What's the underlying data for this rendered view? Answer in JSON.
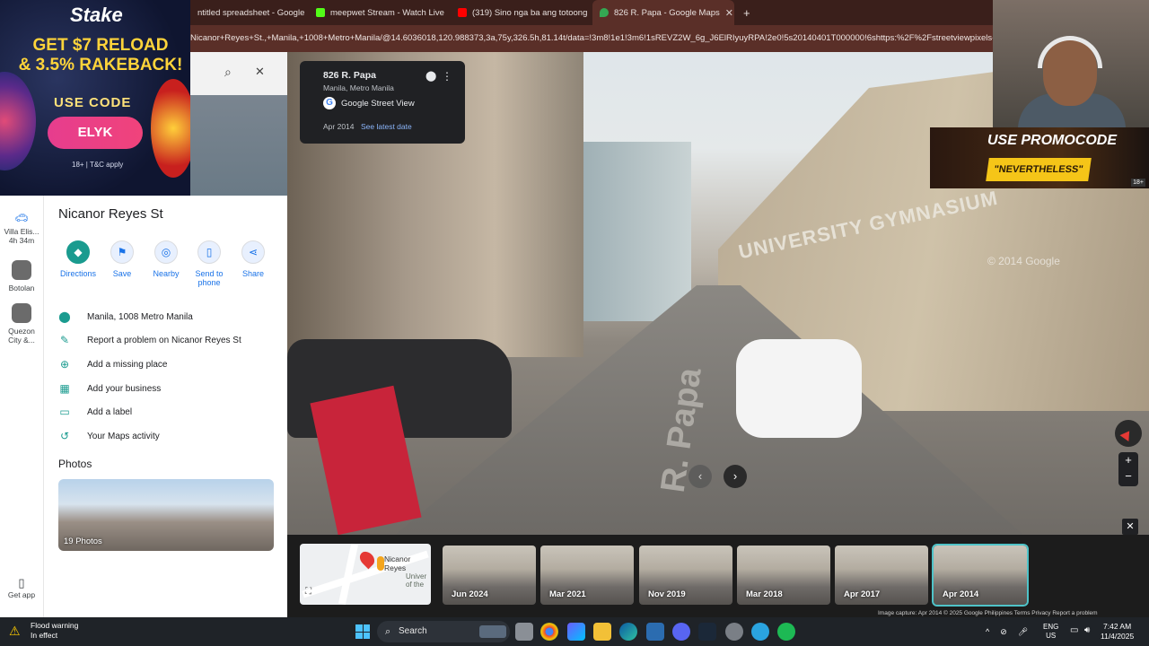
{
  "browser": {
    "tabs": [
      {
        "label": "ntitled spreadsheet - Google",
        "color": "#0f9d58"
      },
      {
        "label": "meepwet Stream - Watch Live",
        "color": "#53fc18"
      },
      {
        "label": "(319) Sino nga ba ang totoong",
        "color": "#ff0000"
      },
      {
        "label": "826 R. Papa - Google Maps",
        "color": "#34a853"
      }
    ],
    "new_tab": "+",
    "url": "Nicanor+Reyes+St.,+Manila,+1008+Metro+Manila/@14.6036018,120.988373,3a,75y,326.5h,81.14t/data=!3m8!1e1!3m6!1sREVZ2W_6g_J6ElRIyuyRPA!2e0!5s20140401T000000!6shttps:%2F%2Fstreetviewpixels-pa.googleap"
  },
  "ad": {
    "brand": "Stake",
    "line1": "GET $7 RELOAD",
    "line2": "& 3.5% RAKEBACK!",
    "use_code": "USE CODE",
    "code": "ELYK",
    "terms": "18+ | T&C apply"
  },
  "leftrail": [
    {
      "label": "Villa Elis...",
      "sub": "4h 34m"
    },
    {
      "label": "Botolan",
      "sub": ""
    },
    {
      "label": "Quezon",
      "sub": "City &..."
    }
  ],
  "get_app": "Get app",
  "panel": {
    "title": "Nicanor Reyes St",
    "actions": [
      {
        "label": "Directions",
        "icon": "◆"
      },
      {
        "label": "Save",
        "icon": "⚑"
      },
      {
        "label": "Nearby",
        "icon": "◎"
      },
      {
        "label": "Send to phone",
        "icon": "▯"
      },
      {
        "label": "Share",
        "icon": "⋖"
      }
    ],
    "rows": [
      {
        "label": "Manila, 1008 Metro Manila",
        "icon": "location-pin-icon"
      },
      {
        "label": "Report a problem on Nicanor Reyes St",
        "icon": "pencil-icon"
      },
      {
        "label": "Add a missing place",
        "icon": "add-place-icon"
      },
      {
        "label": "Add your business",
        "icon": "store-icon"
      },
      {
        "label": "Add a label",
        "icon": "label-icon"
      },
      {
        "label": "Your Maps activity",
        "icon": "history-icon"
      }
    ],
    "photos_title": "Photos",
    "photos_caption": "19 Photos"
  },
  "streetview": {
    "address": "826 R. Papa",
    "city": "Manila, Metro Manila",
    "source": "Google Street View",
    "date": "Apr 2014",
    "latest": "See latest date",
    "road_label": "R. Papa",
    "building_sign": "UNIVERSITY GYMNASIUM",
    "watermark": "© 2014 Google"
  },
  "minimap": {
    "street": "Nicanor Reyes",
    "poi": "Univer of the"
  },
  "timeline": [
    "Jun 2024",
    "Mar 2021",
    "Nov 2019",
    "Mar 2018",
    "Apr 2017",
    "Apr 2014"
  ],
  "credits": "Image capture: Apr 2014   © 2025 Google   Philippines   Terms   Privacy   Report a problem",
  "promo": {
    "line1": "USE PROMOCODE",
    "line2": "\"NEVERTHELESS\"",
    "age": "18+"
  },
  "taskbar": {
    "weather_title": "Flood warning",
    "weather_sub": "In effect",
    "search": "Search",
    "lang1": "ENG",
    "lang2": "US",
    "time": "7:42 AM",
    "date": "11/4/2025"
  }
}
